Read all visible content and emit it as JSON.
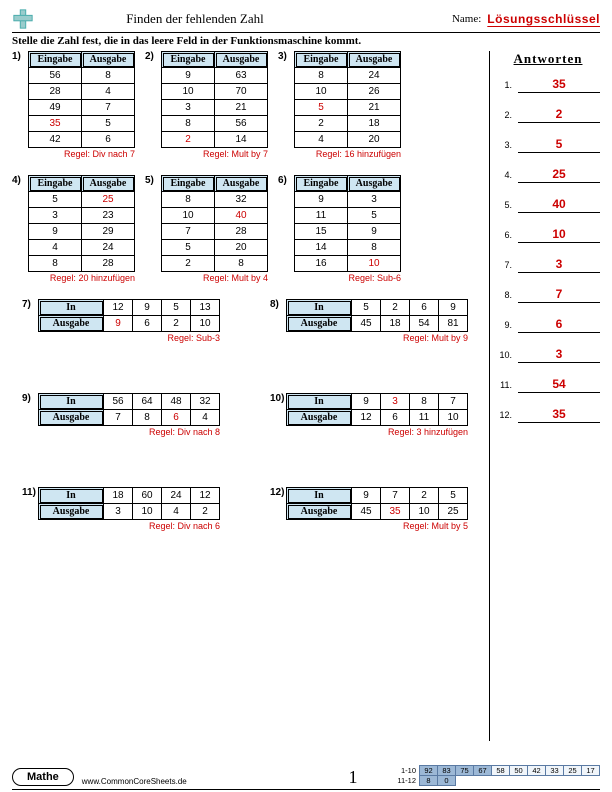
{
  "header": {
    "title": "Finden der fehlenden Zahl",
    "name_label": "Name:",
    "answer_key": "Lösungsschlüssel"
  },
  "instruction": "Stelle die Zahl fest, die in das leere Feld in der Funktionsmaschine kommt.",
  "col_labels": {
    "in": "Eingabe",
    "out": "Ausgabe",
    "in_short": "In"
  },
  "problems_v": [
    {
      "n": "1",
      "rows": [
        [
          "56",
          "8"
        ],
        [
          "28",
          "4"
        ],
        [
          "49",
          "7"
        ],
        [
          "35",
          "5"
        ],
        [
          "42",
          "6"
        ]
      ],
      "red_row": 3,
      "red_col": 0,
      "rule": "Regel: Div nach 7"
    },
    {
      "n": "2",
      "rows": [
        [
          "9",
          "63"
        ],
        [
          "10",
          "70"
        ],
        [
          "3",
          "21"
        ],
        [
          "8",
          "56"
        ],
        [
          "2",
          "14"
        ]
      ],
      "red_row": 4,
      "red_col": 0,
      "rule": "Regel: Mult by 7"
    },
    {
      "n": "3",
      "rows": [
        [
          "8",
          "24"
        ],
        [
          "10",
          "26"
        ],
        [
          "5",
          "21"
        ],
        [
          "2",
          "18"
        ],
        [
          "4",
          "20"
        ]
      ],
      "red_row": 2,
      "red_col": 0,
      "rule": "Regel: 16 hinzufügen"
    },
    {
      "n": "4",
      "rows": [
        [
          "5",
          "25"
        ],
        [
          "3",
          "23"
        ],
        [
          "9",
          "29"
        ],
        [
          "4",
          "24"
        ],
        [
          "8",
          "28"
        ]
      ],
      "red_row": 0,
      "red_col": 1,
      "rule": "Regel: 20 hinzufügen"
    },
    {
      "n": "5",
      "rows": [
        [
          "8",
          "32"
        ],
        [
          "10",
          "40"
        ],
        [
          "7",
          "28"
        ],
        [
          "5",
          "20"
        ],
        [
          "2",
          "8"
        ]
      ],
      "red_row": 1,
      "red_col": 1,
      "rule": "Regel: Mult by 4"
    },
    {
      "n": "6",
      "rows": [
        [
          "9",
          "3"
        ],
        [
          "11",
          "5"
        ],
        [
          "15",
          "9"
        ],
        [
          "14",
          "8"
        ],
        [
          "16",
          "10"
        ]
      ],
      "red_row": 4,
      "red_col": 1,
      "rule": "Regel: Sub-6"
    }
  ],
  "problems_h": [
    {
      "n": "7",
      "in": [
        "12",
        "9",
        "5",
        "13"
      ],
      "out": [
        "9",
        "6",
        "2",
        "10"
      ],
      "red_idx": 0,
      "red_side": "out",
      "red_val": "3",
      "rule": "Regel: Sub-3",
      "in_replace_idx": 0,
      "in_replace_val": "12"
    },
    {
      "n": "8",
      "in": [
        "5",
        "2",
        "6",
        "9"
      ],
      "out": [
        "45",
        "18",
        "54",
        "81"
      ],
      "red_idx": null,
      "rule": "Regel: Mult by 9"
    },
    {
      "n": "9",
      "in": [
        "56",
        "64",
        "48",
        "32"
      ],
      "out": [
        "7",
        "8",
        "6",
        "4"
      ],
      "red_idx": 2,
      "red_side": "out",
      "rule": "Regel: Div nach 8"
    },
    {
      "n": "10",
      "in": [
        "9",
        "3",
        "8",
        "7"
      ],
      "out": [
        "12",
        "6",
        "11",
        "10"
      ],
      "red_idx": 1,
      "red_side": "in",
      "rule": "Regel: 3 hinzufügen"
    },
    {
      "n": "11",
      "in": [
        "18",
        "60",
        "24",
        "12"
      ],
      "out": [
        "3",
        "10",
        "4",
        "2"
      ],
      "red_idx": null,
      "rule": "Regel: Div nach 6"
    },
    {
      "n": "12",
      "in": [
        "9",
        "7",
        "2",
        "5"
      ],
      "out": [
        "45",
        "35",
        "10",
        "25"
      ],
      "red_idx": 1,
      "red_side": "out",
      "rule": "Regel: Mult by 5"
    }
  ],
  "answers_title": "Antworten",
  "answers": [
    "35",
    "2",
    "5",
    "25",
    "40",
    "10",
    "3",
    "7",
    "6",
    "3",
    "54",
    "35"
  ],
  "footer": {
    "subject": "Mathe",
    "url": "www.CommonCoreSheets.de",
    "page": "1",
    "score_labels": [
      "1-10",
      "11-12"
    ],
    "score_rows": [
      [
        "92",
        "83",
        "75",
        "67",
        "58",
        "50",
        "42",
        "33",
        "25",
        "17"
      ],
      [
        "8",
        "0"
      ]
    ]
  },
  "chart_data": {
    "type": "table",
    "title": "Function machine worksheet answer key",
    "problems": [
      {
        "id": 1,
        "rule": "divide by 7",
        "pairs": [
          [
            56,
            8
          ],
          [
            28,
            4
          ],
          [
            49,
            7
          ],
          [
            35,
            5
          ],
          [
            42,
            6
          ]
        ],
        "missing": 35
      },
      {
        "id": 2,
        "rule": "multiply by 7",
        "pairs": [
          [
            9,
            63
          ],
          [
            10,
            70
          ],
          [
            3,
            21
          ],
          [
            8,
            56
          ],
          [
            2,
            14
          ]
        ],
        "missing": 2
      },
      {
        "id": 3,
        "rule": "add 16",
        "pairs": [
          [
            8,
            24
          ],
          [
            10,
            26
          ],
          [
            5,
            21
          ],
          [
            2,
            18
          ],
          [
            4,
            20
          ]
        ],
        "missing": 5
      },
      {
        "id": 4,
        "rule": "add 20",
        "pairs": [
          [
            5,
            25
          ],
          [
            3,
            23
          ],
          [
            9,
            29
          ],
          [
            4,
            24
          ],
          [
            8,
            28
          ]
        ],
        "missing": 25
      },
      {
        "id": 5,
        "rule": "multiply by 4",
        "pairs": [
          [
            8,
            32
          ],
          [
            10,
            40
          ],
          [
            7,
            28
          ],
          [
            5,
            20
          ],
          [
            2,
            8
          ]
        ],
        "missing": 40
      },
      {
        "id": 6,
        "rule": "subtract 6",
        "pairs": [
          [
            9,
            3
          ],
          [
            11,
            5
          ],
          [
            15,
            9
          ],
          [
            14,
            8
          ],
          [
            16,
            10
          ]
        ],
        "missing": 10
      },
      {
        "id": 7,
        "rule": "subtract 3",
        "pairs": [
          [
            12,
            9
          ],
          [
            9,
            6
          ],
          [
            5,
            2
          ],
          [
            13,
            10
          ]
        ],
        "missing": 3
      },
      {
        "id": 8,
        "rule": "multiply by 9",
        "pairs": [
          [
            5,
            45
          ],
          [
            2,
            18
          ],
          [
            6,
            54
          ],
          [
            9,
            81
          ]
        ],
        "missing": 7
      },
      {
        "id": 9,
        "rule": "divide by 8",
        "pairs": [
          [
            56,
            7
          ],
          [
            64,
            8
          ],
          [
            48,
            6
          ],
          [
            32,
            4
          ]
        ],
        "missing": 6
      },
      {
        "id": 10,
        "rule": "add 3",
        "pairs": [
          [
            9,
            12
          ],
          [
            3,
            6
          ],
          [
            8,
            11
          ],
          [
            7,
            10
          ]
        ],
        "missing": 3
      },
      {
        "id": 11,
        "rule": "divide by 6",
        "pairs": [
          [
            18,
            3
          ],
          [
            60,
            10
          ],
          [
            24,
            4
          ],
          [
            12,
            2
          ]
        ],
        "missing": 54
      },
      {
        "id": 12,
        "rule": "multiply by 5",
        "pairs": [
          [
            9,
            45
          ],
          [
            7,
            35
          ],
          [
            2,
            10
          ],
          [
            5,
            25
          ]
        ],
        "missing": 35
      }
    ]
  }
}
